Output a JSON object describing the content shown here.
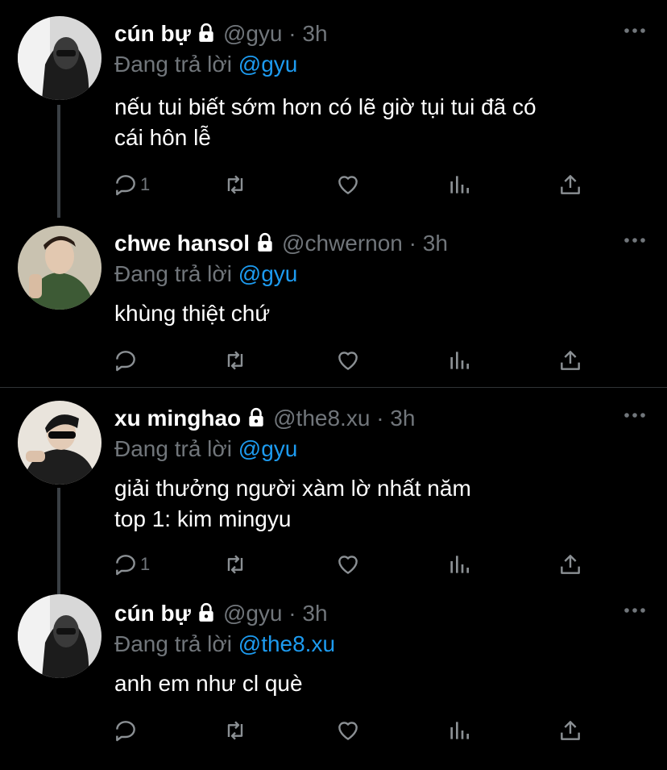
{
  "tweets": [
    {
      "name": "cún bự",
      "handle": "@gyu",
      "separator": "·",
      "time": "3h",
      "replying_prefix": "Đang trả lời ",
      "replying_to": "@gyu",
      "lines": [
        "nếu tui biết sớm hơn có lẽ giờ tụi tui đã có",
        "cái hôn lễ"
      ],
      "reply_count": "1"
    },
    {
      "name": "chwe hansol",
      "handle": "@chwernon",
      "separator": "·",
      "time": "3h",
      "replying_prefix": "Đang trả lời ",
      "replying_to": "@gyu",
      "lines": [
        "khùng thiệt chứ"
      ],
      "reply_count": ""
    },
    {
      "name": "xu minghao",
      "handle": "@the8.xu",
      "separator": "·",
      "time": "3h",
      "replying_prefix": "Đang trả lời ",
      "replying_to": "@gyu",
      "lines": [
        "giải thưởng người xàm lờ nhất năm",
        "top 1: kim mingyu"
      ],
      "reply_count": "1"
    },
    {
      "name": "cún bự",
      "handle": "@gyu",
      "separator": "·",
      "time": "3h",
      "replying_prefix": "Đang trả lời ",
      "replying_to": "@the8.xu",
      "lines": [
        "anh em như cl què"
      ],
      "reply_count": ""
    }
  ],
  "icons": {
    "lock": "lock-icon",
    "more": "more-icon",
    "reply": "reply-icon",
    "retweet": "retweet-icon",
    "like": "like-icon",
    "analytics": "analytics-icon",
    "share": "share-icon"
  },
  "colors": {
    "background": "#000000",
    "text": "#ffffff",
    "secondary": "#71767b",
    "link": "#1d9bf0",
    "thread_line": "#3a3f44"
  }
}
